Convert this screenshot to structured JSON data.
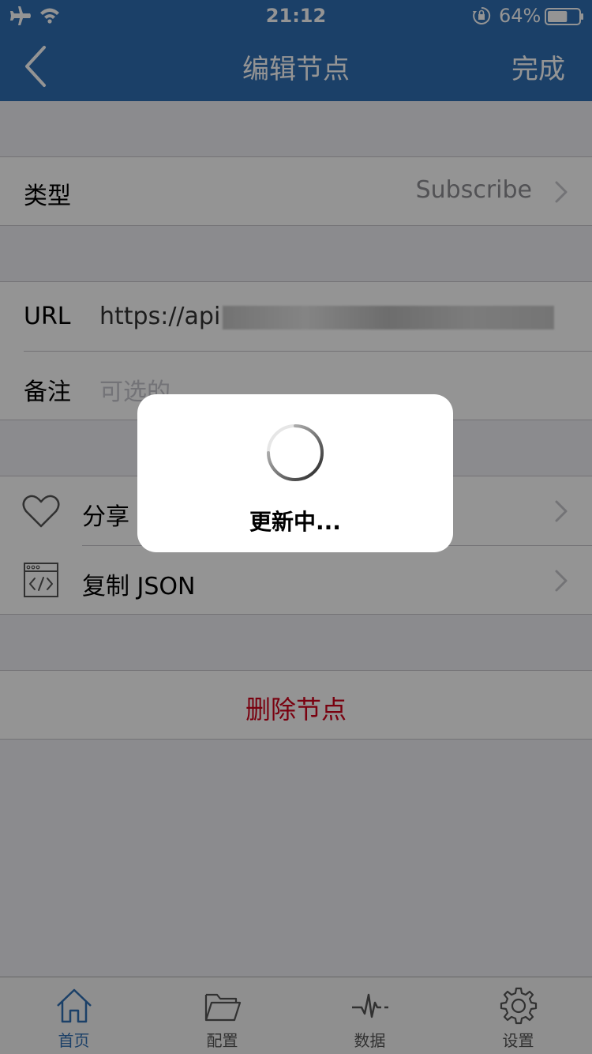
{
  "status_bar": {
    "time": "21:12",
    "battery_percent": "64%",
    "battery_level": 0.64,
    "icons": [
      "airplane-icon",
      "wifi-icon",
      "orientation-lock-icon",
      "battery-icon"
    ]
  },
  "nav": {
    "title": "编辑节点",
    "done_label": "完成",
    "back_icon": "chevron-left-icon"
  },
  "form": {
    "type_label": "类型",
    "type_value": "Subscribe",
    "url_label": "URL",
    "url_value": "https://api",
    "remark_label": "备注",
    "remark_placeholder": "可选的"
  },
  "actions": {
    "share_label": "分享",
    "share_icon": "heart-icon",
    "copy_json_label": "复制 JSON",
    "copy_json_icon": "code-window-icon",
    "delete_label": "删除节点"
  },
  "hud": {
    "message": "更新中..."
  },
  "tabs": [
    {
      "label": "首页",
      "icon": "home-icon",
      "active": true
    },
    {
      "label": "配置",
      "icon": "folder-icon",
      "active": false
    },
    {
      "label": "数据",
      "icon": "pulse-icon",
      "active": false
    },
    {
      "label": "设置",
      "icon": "gear-icon",
      "active": false
    }
  ],
  "colors": {
    "nav_background": "#2f6fb4",
    "delete_text": "#d0021b",
    "active_tab": "#2f6fb4",
    "group_background": "#efeff4"
  }
}
